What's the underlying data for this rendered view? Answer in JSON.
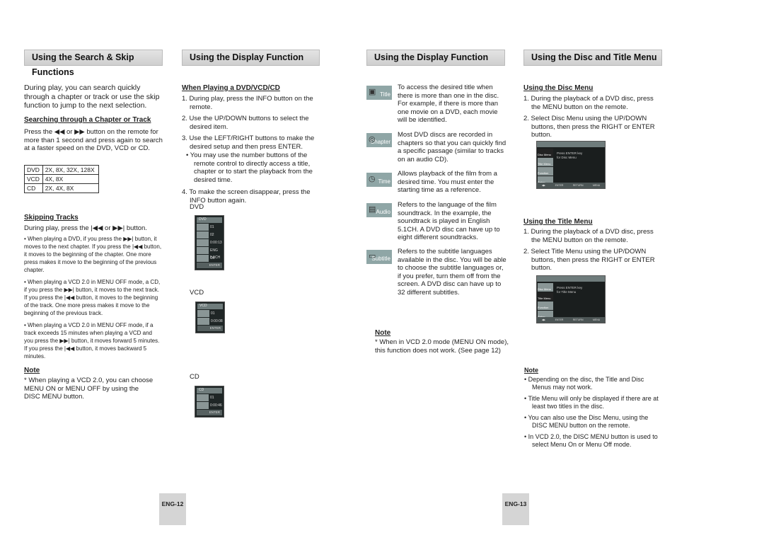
{
  "headers": [
    "Using the Search & Skip Functions",
    "Using the Display Function",
    "Using the Display Function",
    "Using the Disc and Title Menu"
  ],
  "col1": {
    "intro": "During play, you can search quickly through a chapter or track or use the skip function to jump to the next selection.",
    "search_heading": "Searching through a Chapter or Track",
    "search_text": "Press the ◀◀ or ▶▶ button on the remote for more than 1 second and press again to search at a faster speed on the DVD, VCD or CD.",
    "speed_table": [
      [
        "DVD",
        "2X, 8X, 32X, 128X"
      ],
      [
        "VCD",
        "4X, 8X"
      ],
      [
        "CD",
        "2X, 4X, 8X"
      ]
    ],
    "skip_heading": "Skipping Tracks",
    "skip_text": "During play, press the |◀◀ or ▶▶| button.",
    "bullets": [
      "• When playing a DVD, if you press the ▶▶| button, it moves to the next chapter. If you press the |◀◀ button, it moves to the beginning of the chapter. One more press makes it move to the beginning of the previous chapter.",
      "• When playing a VCD 2.0 in MENU OFF mode, a CD, if you press the ▶▶| button, it moves to the next track. If you press the |◀◀ button, it moves to the beginning of the track. One more press makes it move to the beginning of the previous track.",
      "• When playing a VCD 2.0 in MENU OFF mode, if a track exceeds 15 minutes when playing a VCD and you press the ▶▶| button, it moves forward 5 minutes. If you press the |◀◀ button, it moves backward 5 minutes."
    ],
    "note_heading": "Note",
    "note": "* When playing a VCD 2.0, you can choose MENU ON or MENU OFF by using the DISC MENU button."
  },
  "col2": {
    "heading": "When Playing a DVD/VCD/CD",
    "steps": [
      "1. During play, press the INFO button on the remote.",
      "2. Use the UP/DOWN buttons to select the desired item.",
      "3. Use the LEFT/RIGHT buttons to make the desired setup and then press ENTER.",
      "4. To make the screen disappear, press the INFO button again."
    ],
    "step3_sub": "• You may use the number buttons of the remote control to directly access a title, chapter or to start the playback from the desired time.",
    "labels": [
      "DVD",
      "VCD",
      "CD"
    ],
    "osd_dvd": {
      "title": "DVD",
      "rows": [
        "01",
        "02",
        "0:00:13",
        "ENG 5.1CH",
        "Off"
      ],
      "enter": "ENTER"
    },
    "osd_vcd": {
      "title": "VCD",
      "rows": [
        "01",
        "0:00:08"
      ],
      "enter": "ENTER"
    },
    "osd_cd": {
      "title": "CD",
      "rows": [
        "01",
        "0:00:46"
      ],
      "enter": "ENTER"
    }
  },
  "col3": {
    "items": [
      {
        "icon": "Title",
        "text": "To access the desired title when there is more than one in the disc. For example, if there is more than one movie on a DVD, each movie will be identified."
      },
      {
        "icon": "Chapter",
        "text": "Most DVD discs are recorded in chapters so that you can quickly find a specific passage (similar to tracks on an audio CD)."
      },
      {
        "icon": "Time",
        "text": "Allows playback of the film from a desired time. You must enter the starting time as a reference."
      },
      {
        "icon": "Audio",
        "text": "Refers to the language of the film soundtrack. In the example, the soundtrack is played in English 5.1CH. A DVD disc can have up to eight different soundtracks."
      },
      {
        "icon": "Subtitle",
        "text": "Refers to the subtitle languages available in the disc. You will be able to choose the subtitle languages or, if you prefer, turn them off from the screen. A DVD disc can have up to 32 different subtitles."
      }
    ],
    "note_heading": "Note",
    "note": "* When in VCD 2.0 mode (MENU ON mode), this function does not work. (See page 12)"
  },
  "col4": {
    "disc_heading": "Using the Disc Menu",
    "disc_steps": [
      "1. During the playback of a DVD disc, press the MENU button on the remote.",
      "2. Select Disc Menu using the UP/DOWN buttons, then press the RIGHT or ENTER button."
    ],
    "disc_screen": {
      "side": [
        "Disc Menu",
        "Title Menu",
        "Function",
        "Setup"
      ],
      "msg1": "Press ENTER key",
      "msg2": "for Disc Menu",
      "bottom": [
        "◀▶",
        "ENTER",
        "RETURN",
        "MENU"
      ]
    },
    "title_heading": "Using the Title Menu",
    "title_steps": [
      "1. During the playback of a DVD disc, press the MENU button on the remote.",
      "2. Select Title Menu using the UP/DOWN buttons, then press the RIGHT or ENTER button."
    ],
    "title_screen": {
      "msg1": "Press ENTER key",
      "msg2": "for Title Menu"
    },
    "note_heading": "Note",
    "notes": [
      "• Depending on the disc, the Title and Disc Menus may not work.",
      "• Title Menu will only be displayed if there are at least two titles in the disc.",
      "• You can also use the Disc Menu, using the DISC MENU button on the remote.",
      "• In VCD 2.0, the DISC MENU button is used to select Menu On or Menu Off mode."
    ]
  },
  "page_numbers": [
    "ENG-12",
    "ENG-13"
  ]
}
